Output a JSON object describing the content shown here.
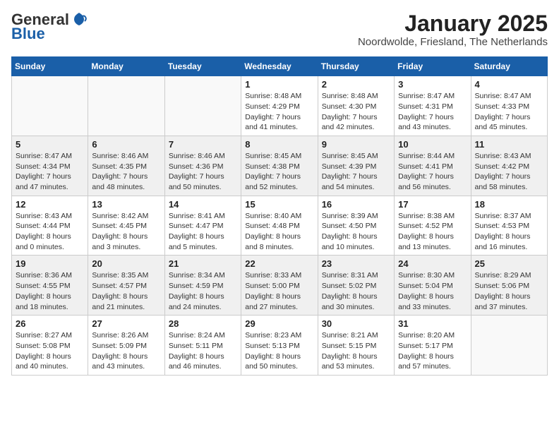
{
  "header": {
    "logo_general": "General",
    "logo_blue": "Blue",
    "month_title": "January 2025",
    "location": "Noordwolde, Friesland, The Netherlands"
  },
  "weekdays": [
    "Sunday",
    "Monday",
    "Tuesday",
    "Wednesday",
    "Thursday",
    "Friday",
    "Saturday"
  ],
  "weeks": [
    [
      {
        "num": "",
        "info": ""
      },
      {
        "num": "",
        "info": ""
      },
      {
        "num": "",
        "info": ""
      },
      {
        "num": "1",
        "info": "Sunrise: 8:48 AM\nSunset: 4:29 PM\nDaylight: 7 hours\nand 41 minutes."
      },
      {
        "num": "2",
        "info": "Sunrise: 8:48 AM\nSunset: 4:30 PM\nDaylight: 7 hours\nand 42 minutes."
      },
      {
        "num": "3",
        "info": "Sunrise: 8:47 AM\nSunset: 4:31 PM\nDaylight: 7 hours\nand 43 minutes."
      },
      {
        "num": "4",
        "info": "Sunrise: 8:47 AM\nSunset: 4:33 PM\nDaylight: 7 hours\nand 45 minutes."
      }
    ],
    [
      {
        "num": "5",
        "info": "Sunrise: 8:47 AM\nSunset: 4:34 PM\nDaylight: 7 hours\nand 47 minutes."
      },
      {
        "num": "6",
        "info": "Sunrise: 8:46 AM\nSunset: 4:35 PM\nDaylight: 7 hours\nand 48 minutes."
      },
      {
        "num": "7",
        "info": "Sunrise: 8:46 AM\nSunset: 4:36 PM\nDaylight: 7 hours\nand 50 minutes."
      },
      {
        "num": "8",
        "info": "Sunrise: 8:45 AM\nSunset: 4:38 PM\nDaylight: 7 hours\nand 52 minutes."
      },
      {
        "num": "9",
        "info": "Sunrise: 8:45 AM\nSunset: 4:39 PM\nDaylight: 7 hours\nand 54 minutes."
      },
      {
        "num": "10",
        "info": "Sunrise: 8:44 AM\nSunset: 4:41 PM\nDaylight: 7 hours\nand 56 minutes."
      },
      {
        "num": "11",
        "info": "Sunrise: 8:43 AM\nSunset: 4:42 PM\nDaylight: 7 hours\nand 58 minutes."
      }
    ],
    [
      {
        "num": "12",
        "info": "Sunrise: 8:43 AM\nSunset: 4:44 PM\nDaylight: 8 hours\nand 0 minutes."
      },
      {
        "num": "13",
        "info": "Sunrise: 8:42 AM\nSunset: 4:45 PM\nDaylight: 8 hours\nand 3 minutes."
      },
      {
        "num": "14",
        "info": "Sunrise: 8:41 AM\nSunset: 4:47 PM\nDaylight: 8 hours\nand 5 minutes."
      },
      {
        "num": "15",
        "info": "Sunrise: 8:40 AM\nSunset: 4:48 PM\nDaylight: 8 hours\nand 8 minutes."
      },
      {
        "num": "16",
        "info": "Sunrise: 8:39 AM\nSunset: 4:50 PM\nDaylight: 8 hours\nand 10 minutes."
      },
      {
        "num": "17",
        "info": "Sunrise: 8:38 AM\nSunset: 4:52 PM\nDaylight: 8 hours\nand 13 minutes."
      },
      {
        "num": "18",
        "info": "Sunrise: 8:37 AM\nSunset: 4:53 PM\nDaylight: 8 hours\nand 16 minutes."
      }
    ],
    [
      {
        "num": "19",
        "info": "Sunrise: 8:36 AM\nSunset: 4:55 PM\nDaylight: 8 hours\nand 18 minutes."
      },
      {
        "num": "20",
        "info": "Sunrise: 8:35 AM\nSunset: 4:57 PM\nDaylight: 8 hours\nand 21 minutes."
      },
      {
        "num": "21",
        "info": "Sunrise: 8:34 AM\nSunset: 4:59 PM\nDaylight: 8 hours\nand 24 minutes."
      },
      {
        "num": "22",
        "info": "Sunrise: 8:33 AM\nSunset: 5:00 PM\nDaylight: 8 hours\nand 27 minutes."
      },
      {
        "num": "23",
        "info": "Sunrise: 8:31 AM\nSunset: 5:02 PM\nDaylight: 8 hours\nand 30 minutes."
      },
      {
        "num": "24",
        "info": "Sunrise: 8:30 AM\nSunset: 5:04 PM\nDaylight: 8 hours\nand 33 minutes."
      },
      {
        "num": "25",
        "info": "Sunrise: 8:29 AM\nSunset: 5:06 PM\nDaylight: 8 hours\nand 37 minutes."
      }
    ],
    [
      {
        "num": "26",
        "info": "Sunrise: 8:27 AM\nSunset: 5:08 PM\nDaylight: 8 hours\nand 40 minutes."
      },
      {
        "num": "27",
        "info": "Sunrise: 8:26 AM\nSunset: 5:09 PM\nDaylight: 8 hours\nand 43 minutes."
      },
      {
        "num": "28",
        "info": "Sunrise: 8:24 AM\nSunset: 5:11 PM\nDaylight: 8 hours\nand 46 minutes."
      },
      {
        "num": "29",
        "info": "Sunrise: 8:23 AM\nSunset: 5:13 PM\nDaylight: 8 hours\nand 50 minutes."
      },
      {
        "num": "30",
        "info": "Sunrise: 8:21 AM\nSunset: 5:15 PM\nDaylight: 8 hours\nand 53 minutes."
      },
      {
        "num": "31",
        "info": "Sunrise: 8:20 AM\nSunset: 5:17 PM\nDaylight: 8 hours\nand 57 minutes."
      },
      {
        "num": "",
        "info": ""
      }
    ]
  ]
}
